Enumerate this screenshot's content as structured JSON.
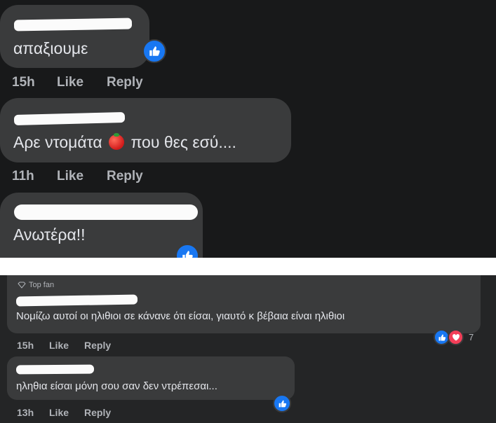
{
  "top_comments": [
    {
      "text": "απαξιουμε",
      "time": "15h",
      "like": "Like",
      "reply": "Reply"
    },
    {
      "text_before": "Αρε ντομάτα",
      "text_after": "που θες εσύ....",
      "emoji": "tomato-emoji",
      "time": "11h",
      "like": "Like",
      "reply": "Reply"
    },
    {
      "text": "Ανωτέρα!!"
    }
  ],
  "bottom_comments": [
    {
      "badge": "Top fan",
      "text": "Νομίζω αυτοί οι ηλιθιοι σε κάνανε ότι είσαι, γιαυτό κ βέβαια είναι ηλιθιοι",
      "time": "15h",
      "like": "Like",
      "reply": "Reply",
      "reaction_count": "7"
    },
    {
      "text": "ηληθια είσαι μόνη σου σαν δεν ντρέπεσαι...",
      "time": "13h",
      "like": "Like",
      "reply": "Reply"
    }
  ],
  "icons": {
    "like": "thumbs-up-icon",
    "heart": "heart-icon",
    "top_fan": "diamond-icon"
  },
  "colors": {
    "background_top": "#18191a",
    "background_bottom": "#242526",
    "bubble": "#3a3b3c",
    "text": "#e4e6eb",
    "meta": "#b0b3b8",
    "like_blue": "#1877f2",
    "heart_red": "#f33e58"
  }
}
